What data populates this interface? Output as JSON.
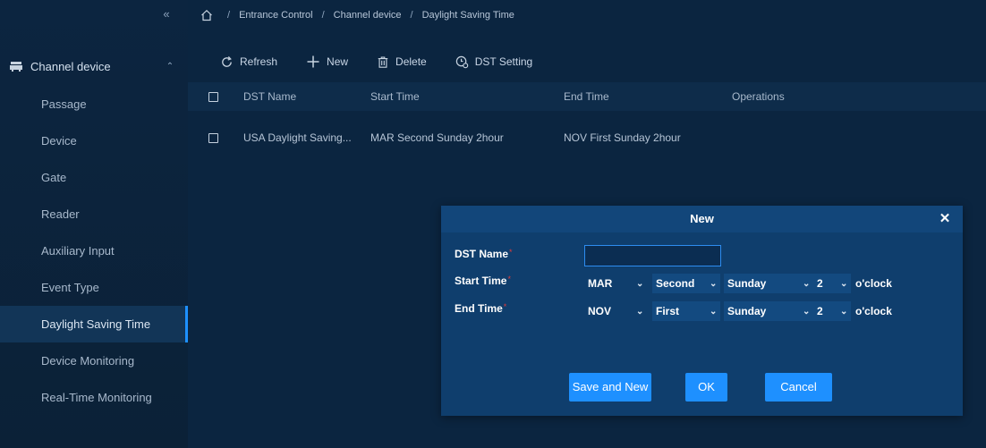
{
  "sidebar": {
    "collapse_icon": "double-chevron-left-icon",
    "parent": {
      "label": "Channel device",
      "icon": "channel-device-icon",
      "caret": "chevron-up-icon"
    },
    "items": [
      {
        "label": "Passage"
      },
      {
        "label": "Device"
      },
      {
        "label": "Gate"
      },
      {
        "label": "Reader"
      },
      {
        "label": "Auxiliary Input"
      },
      {
        "label": "Event Type"
      },
      {
        "label": "Daylight Saving Time",
        "active": true
      },
      {
        "label": "Device Monitoring"
      },
      {
        "label": "Real-Time Monitoring"
      }
    ]
  },
  "breadcrumb": {
    "separator": "/",
    "items": [
      "Entrance Control",
      "Channel device",
      "Daylight Saving Time"
    ]
  },
  "toolbar": {
    "refresh": "Refresh",
    "new": "New",
    "delete": "Delete",
    "dst_setting": "DST Setting"
  },
  "table": {
    "columns": [
      "DST Name",
      "Start Time",
      "End Time",
      "Operations"
    ],
    "rows": [
      {
        "name": "USA Daylight Saving...",
        "start": "MAR Second Sunday 2hour",
        "end": "NOV First Sunday 2hour"
      }
    ]
  },
  "dialog": {
    "title": "New",
    "close_icon": "close-icon",
    "labels": {
      "name": "DST Name",
      "start": "Start Time",
      "end": "End Time",
      "required_mark": "*"
    },
    "name_value": "",
    "start": {
      "month": "MAR",
      "week": "Second",
      "day": "Sunday",
      "hour": "2",
      "suffix": "o'clock"
    },
    "end": {
      "month": "NOV",
      "week": "First",
      "day": "Sunday",
      "hour": "2",
      "suffix": "o'clock"
    },
    "buttons": {
      "save_new": "Save and New",
      "ok": "OK",
      "cancel": "Cancel"
    }
  },
  "colors": {
    "accent": "#1e90ff",
    "dialog_bg": "#0f3e6d",
    "page_bg": "#0b2540",
    "required": "#e03b3b"
  }
}
